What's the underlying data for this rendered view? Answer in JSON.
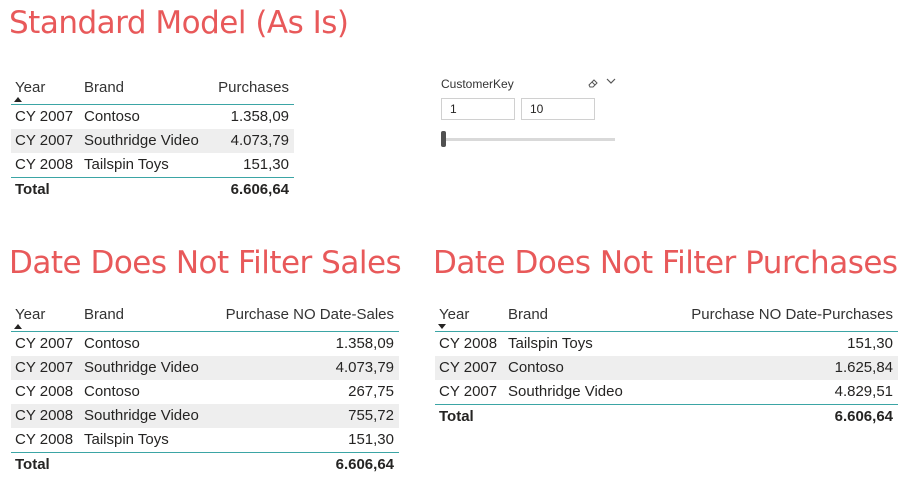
{
  "sections": {
    "standard": "Standard Model (As Is)",
    "no_sales": "Date Does Not Filter Sales",
    "no_purchases": "Date Does Not Filter Purchases"
  },
  "table1": {
    "headers": [
      "Year",
      "Brand",
      "Purchases"
    ],
    "rows": [
      [
        "CY 2007",
        "Contoso",
        "1.358,09"
      ],
      [
        "CY 2007",
        "Southridge Video",
        "4.073,79"
      ],
      [
        "CY 2008",
        "Tailspin Toys",
        "151,30"
      ]
    ],
    "total": [
      "Total",
      "6.606,64"
    ]
  },
  "table2": {
    "headers": [
      "Year",
      "Brand",
      "Purchase NO Date-Sales"
    ],
    "rows": [
      [
        "CY 2007",
        "Contoso",
        "1.358,09"
      ],
      [
        "CY 2007",
        "Southridge Video",
        "4.073,79"
      ],
      [
        "CY 2008",
        "Contoso",
        "267,75"
      ],
      [
        "CY 2008",
        "Southridge Video",
        "755,72"
      ],
      [
        "CY 2008",
        "Tailspin Toys",
        "151,30"
      ]
    ],
    "total": [
      "Total",
      "6.606,64"
    ]
  },
  "table3": {
    "headers": [
      "Year",
      "Brand",
      "Purchase NO Date-Purchases"
    ],
    "rows": [
      [
        "CY 2008",
        "Tailspin Toys",
        "151,30"
      ],
      [
        "CY 2007",
        "Contoso",
        "1.625,84"
      ],
      [
        "CY 2007",
        "Southridge Video",
        "4.829,51"
      ]
    ],
    "total": [
      "Total",
      "6.606,64"
    ]
  },
  "slicer": {
    "label": "CustomerKey",
    "min_value": "1",
    "max_value": "10",
    "icons": [
      "eraser-icon",
      "chevron-down-icon"
    ]
  },
  "colors": {
    "title": "#e8595a",
    "accent_line": "#3ba5a5",
    "alt_row": "#eeeeee"
  }
}
